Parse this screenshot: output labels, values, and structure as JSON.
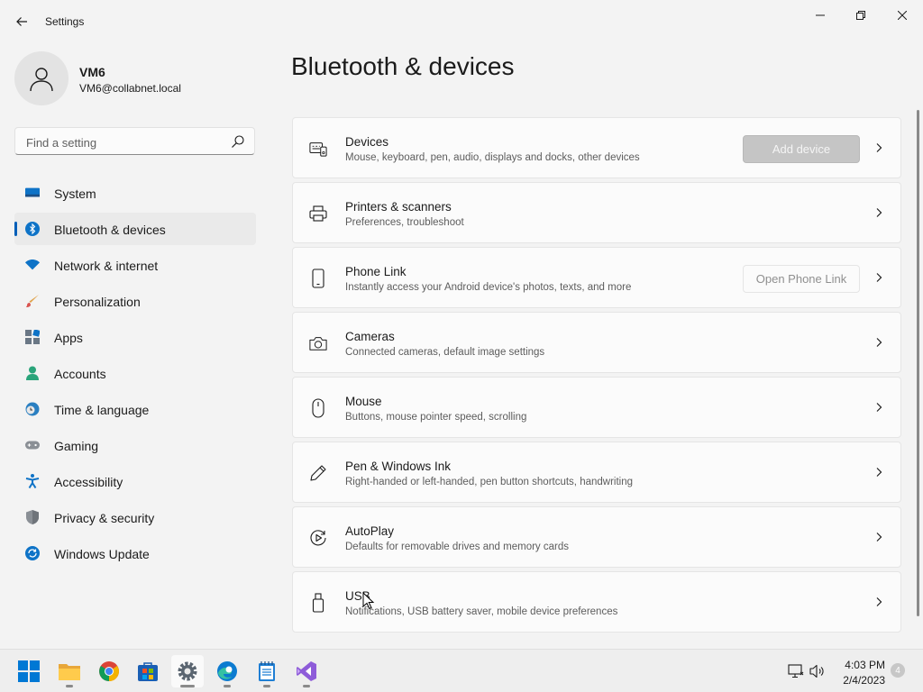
{
  "window": {
    "title": "Settings"
  },
  "profile": {
    "name": "VM6",
    "email": "VM6@collabnet.local"
  },
  "search": {
    "placeholder": "Find a setting"
  },
  "nav": {
    "items": [
      {
        "label": "System",
        "icon": "monitor-icon"
      },
      {
        "label": "Bluetooth & devices",
        "icon": "bluetooth-icon",
        "active": true
      },
      {
        "label": "Network & internet",
        "icon": "wifi-icon"
      },
      {
        "label": "Personalization",
        "icon": "brush-icon"
      },
      {
        "label": "Apps",
        "icon": "apps-icon"
      },
      {
        "label": "Accounts",
        "icon": "person-icon"
      },
      {
        "label": "Time & language",
        "icon": "clock-globe-icon"
      },
      {
        "label": "Gaming",
        "icon": "gamepad-icon"
      },
      {
        "label": "Accessibility",
        "icon": "accessibility-icon"
      },
      {
        "label": "Privacy & security",
        "icon": "shield-icon"
      },
      {
        "label": "Windows Update",
        "icon": "update-icon"
      }
    ]
  },
  "main": {
    "title": "Bluetooth & devices",
    "cards": [
      {
        "title": "Devices",
        "subtitle": "Mouse, keyboard, pen, audio, displays and docks, other devices",
        "icon": "devices-icon",
        "button": "Add device"
      },
      {
        "title": "Printers & scanners",
        "subtitle": "Preferences, troubleshoot",
        "icon": "printer-icon"
      },
      {
        "title": "Phone Link",
        "subtitle": "Instantly access your Android device's photos, texts, and more",
        "icon": "phone-icon",
        "button": "Open Phone Link"
      },
      {
        "title": "Cameras",
        "subtitle": "Connected cameras, default image settings",
        "icon": "camera-icon"
      },
      {
        "title": "Mouse",
        "subtitle": "Buttons, mouse pointer speed, scrolling",
        "icon": "mouse-icon"
      },
      {
        "title": "Pen & Windows Ink",
        "subtitle": "Right-handed or left-handed, pen button shortcuts, handwriting",
        "icon": "pen-icon"
      },
      {
        "title": "AutoPlay",
        "subtitle": "Defaults for removable drives and memory cards",
        "icon": "autoplay-icon"
      },
      {
        "title": "USB",
        "subtitle": "Notifications, USB battery saver, mobile device preferences",
        "icon": "usb-icon"
      }
    ]
  },
  "taskbar": {
    "apps": [
      "start-icon",
      "file-explorer-icon",
      "chrome-icon",
      "store-icon",
      "settings-icon",
      "edge-icon",
      "notepad-icon",
      "visual-studio-icon"
    ],
    "time": "4:03 PM",
    "date": "2/4/2023",
    "notifications": "4"
  },
  "colors": {
    "accent": "#005fb8",
    "background": "#f3f3f3",
    "card": "#fbfbfb"
  }
}
